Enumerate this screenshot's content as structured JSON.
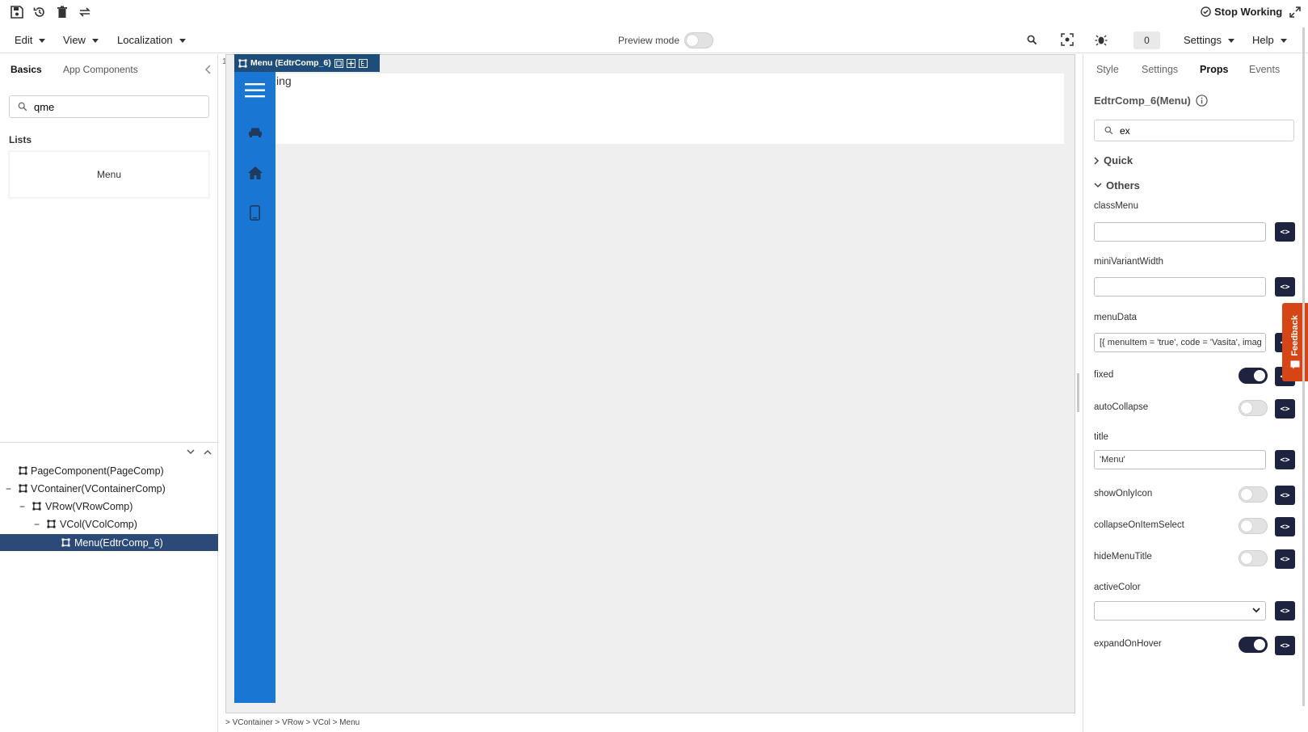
{
  "topbar": {
    "stop_working_label": "Stop Working"
  },
  "menubar": {
    "items": [
      {
        "label": "Edit"
      },
      {
        "label": "View"
      },
      {
        "label": "Localization"
      }
    ],
    "preview_mode_label": "Preview mode",
    "notification_count": "0",
    "settings_label": "Settings",
    "help_label": "Help"
  },
  "left_panel": {
    "tabs": [
      {
        "label": "Basics",
        "active": true
      },
      {
        "label": "App Components",
        "active": false
      }
    ],
    "search_value": "qme",
    "lists_heading": "Lists",
    "menu_card_label": "Menu",
    "tree": [
      {
        "label": "PageComponent(PageComp)",
        "toggle": ""
      },
      {
        "label": "VContainer(VContainerComp)",
        "toggle": "−"
      },
      {
        "label": "VRow(VRowComp)",
        "toggle": "−"
      },
      {
        "label": "VCol(VColComp)",
        "toggle": "−"
      },
      {
        "label": "Menu(EdtrComp_6)",
        "toggle": "",
        "selected": true
      }
    ]
  },
  "canvas": {
    "left_label": "11:",
    "component_header": "Menu (EdtrComp_6)",
    "content_text": "ing",
    "breadcrumb": "> VContainer > VRow > VCol > Menu"
  },
  "right_panel": {
    "tabs": [
      {
        "label": "Style",
        "active": false
      },
      {
        "label": "Settings",
        "active": false
      },
      {
        "label": "Props",
        "active": true
      },
      {
        "label": "Events",
        "active": false
      }
    ],
    "title": "EdtrComp_6(Menu)",
    "search_value": "ex",
    "sections": {
      "quick": "Quick",
      "others": "Others"
    },
    "props": {
      "classMenu": {
        "label": "classMenu",
        "value": ""
      },
      "miniVariantWidth": {
        "label": "miniVariantWidth",
        "value": ""
      },
      "menuData": {
        "label": "menuData",
        "value": "[{ menuItem = 'true', code = 'Vasita', imag"
      },
      "fixed": {
        "label": "fixed",
        "on": true
      },
      "autoCollapse": {
        "label": "autoCollapse",
        "on": false
      },
      "title": {
        "label": "title",
        "value": "'Menu'"
      },
      "showOnlyIcon": {
        "label": "showOnlyIcon",
        "on": false
      },
      "collapseOnItemSelect": {
        "label": "collapseOnItemSelect",
        "on": false
      },
      "hideMenuTitle": {
        "label": "hideMenuTitle",
        "on": false
      },
      "activeColor": {
        "label": "activeColor",
        "value": ""
      },
      "expandOnHover": {
        "label": "expandOnHover",
        "on": true
      }
    },
    "code_button_label": "<>"
  },
  "feedback_label": "Feedback",
  "colors": {
    "menu_sidebar": "#1976d2",
    "selected_tree_row": "#2c4a78",
    "code_button": "#1e2340",
    "feedback": "#d64515"
  }
}
